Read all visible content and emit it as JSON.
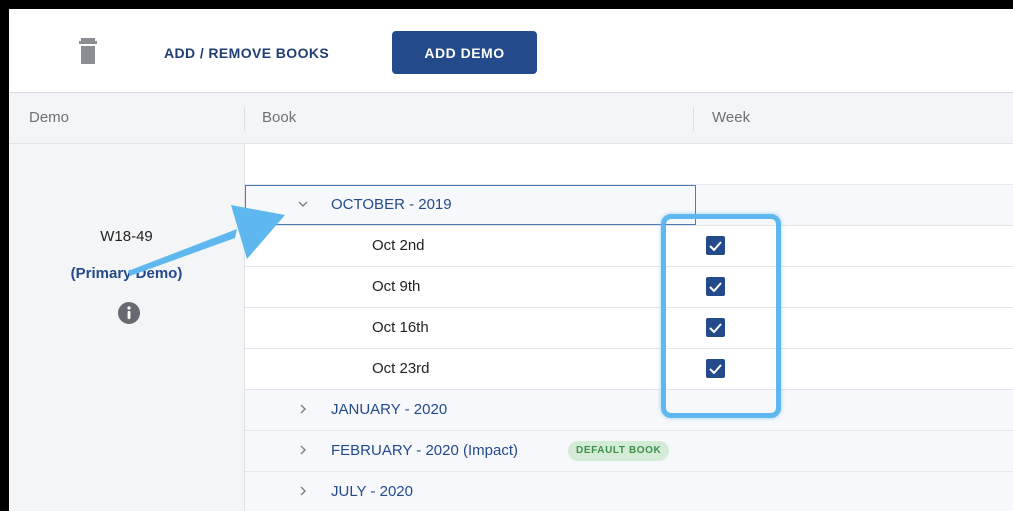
{
  "toolbar": {
    "trash_icon": "trash-icon",
    "add_remove_label": "ADD / REMOVE BOOKS",
    "add_demo_label": "ADD DEMO"
  },
  "table": {
    "columns": [
      "Demo",
      "Book",
      "Week"
    ]
  },
  "demo": {
    "name": "W18-49",
    "subtitle": "(Primary Demo)",
    "info_icon": "info-icon"
  },
  "groups": [
    {
      "label": "OCTOBER - 2019",
      "expanded": true,
      "weeks": [
        {
          "label": "Oct 2nd",
          "checked": true
        },
        {
          "label": "Oct 9th",
          "checked": true
        },
        {
          "label": "Oct 16th",
          "checked": true
        },
        {
          "label": "Oct 23rd",
          "checked": true
        }
      ]
    },
    {
      "label": "JANUARY - 2020",
      "expanded": false
    },
    {
      "label": "FEBRUARY - 2020 (Impact)",
      "expanded": false,
      "badge": "DEFAULT BOOK"
    },
    {
      "label": "JULY - 2020",
      "expanded": false
    }
  ],
  "colors": {
    "primary": "#234a8b",
    "highlight": "#5eb7ee",
    "badge_bg": "#d4ecd6",
    "badge_text": "#3f8f4a"
  }
}
